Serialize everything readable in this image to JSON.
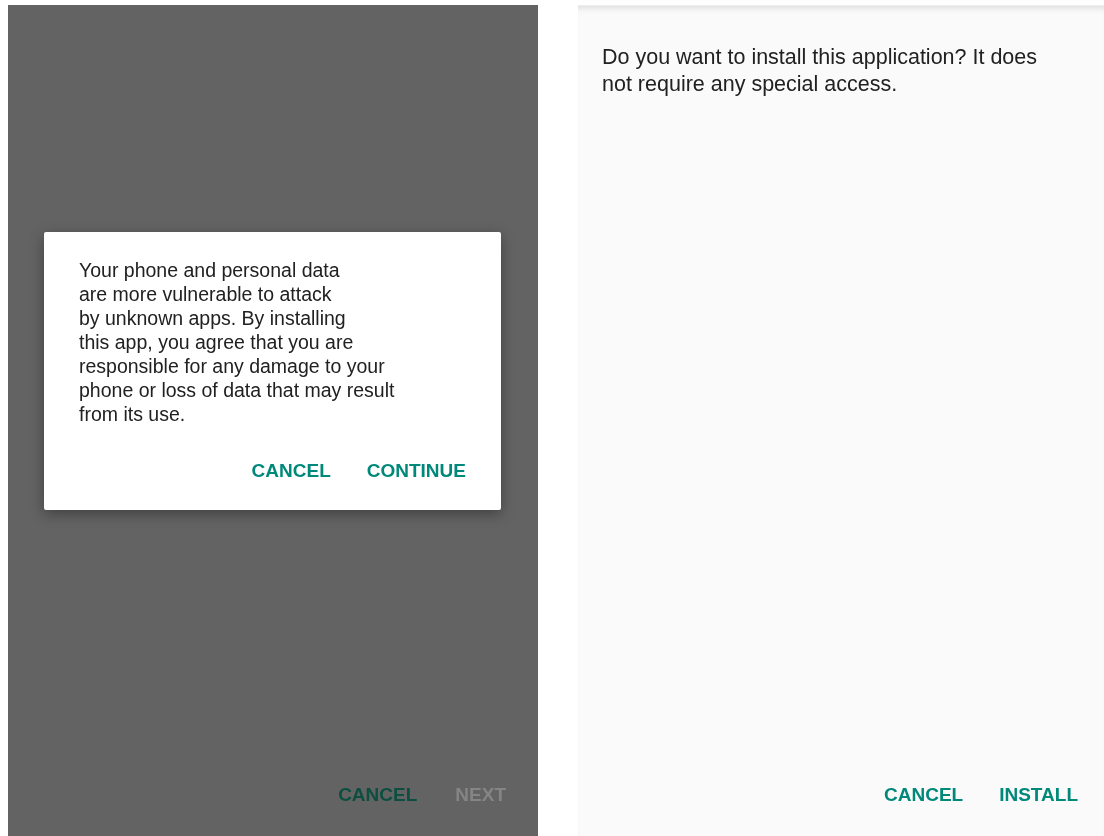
{
  "left_screen": {
    "dimmed": true,
    "footer_buttons": [
      {
        "label": "CANCEL",
        "disabled": false
      },
      {
        "label": "NEXT",
        "disabled": true
      }
    ],
    "dialog": {
      "message": "Your phone and personal data\nare more vulnerable to attack\nby unknown apps. By installing\nthis app, you agree that you are\nresponsible for any damage to your\nphone or loss of data that may result\nfrom its use.",
      "buttons": [
        "CANCEL",
        "CONTINUE"
      ]
    }
  },
  "right_screen": {
    "message": "Do you want to install this application? It does not require any special access.",
    "buttons": [
      "CANCEL",
      "INSTALL"
    ]
  }
}
